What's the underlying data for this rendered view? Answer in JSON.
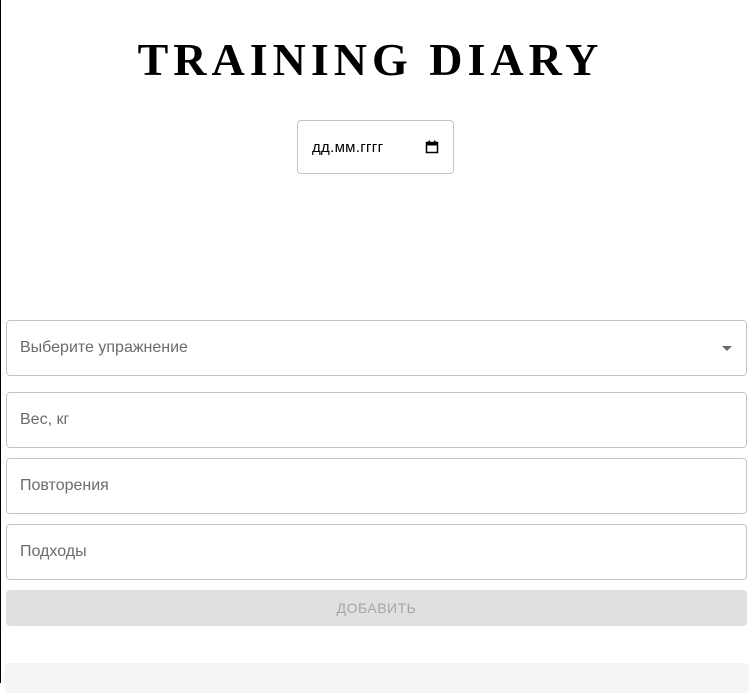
{
  "page": {
    "title": "TRAINING DIARY"
  },
  "date_picker": {
    "placeholder": "дд.мм.гггг",
    "icon": "calendar-icon"
  },
  "form": {
    "exercise_select": {
      "placeholder": "Выберите упражнение",
      "icon": "chevron-down-icon"
    },
    "weight_field": {
      "placeholder": "Вес, кг"
    },
    "reps_field": {
      "placeholder": "Повторения"
    },
    "sets_field": {
      "placeholder": "Подходы"
    },
    "add_button": {
      "label": "ДОБАВИТЬ",
      "disabled": true
    }
  },
  "colors": {
    "border": "#c4c4c4",
    "placeholder_text": "#6b6b6b",
    "disabled_button_bg": "#e0e0e0",
    "disabled_button_text": "#a6a6a6"
  }
}
